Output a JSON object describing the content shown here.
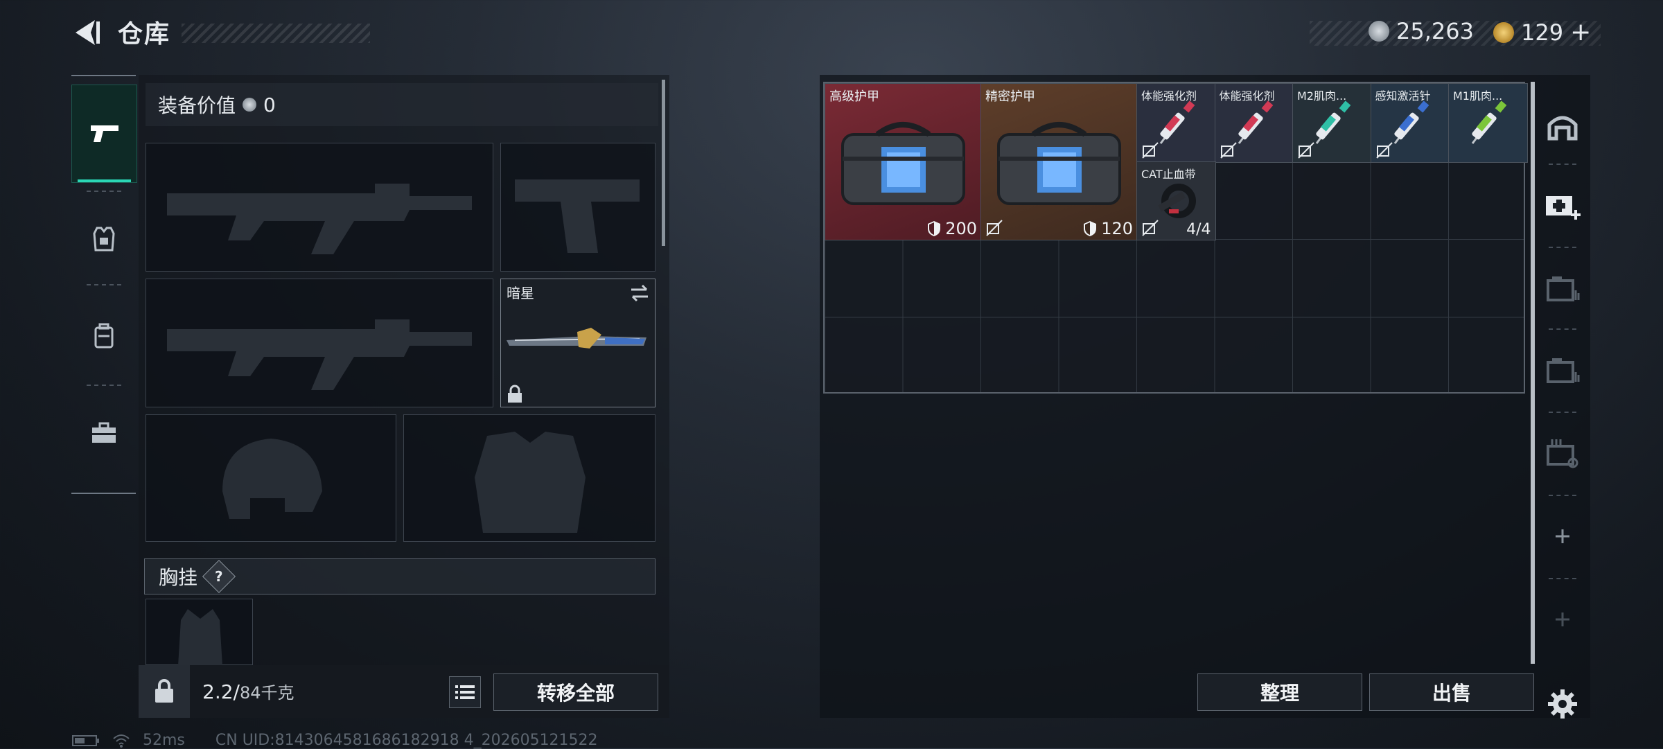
{
  "header": {
    "title": "仓库"
  },
  "currency": {
    "silver": "25,263",
    "gold": "129",
    "gold_add": "+"
  },
  "equipment": {
    "value_label": "装备价值",
    "value": "0",
    "melee_name": "暗星",
    "chest_rig_label": "胸挂",
    "chest_help": "?"
  },
  "footer": {
    "weight_current": "2.2/",
    "weight_max": "84千克",
    "transfer_all_label": "转移全部"
  },
  "stash": {
    "items": [
      {
        "name": "高级护甲",
        "value": "200"
      },
      {
        "name": "精密护甲",
        "value": "120"
      },
      {
        "name": "体能强化剂"
      },
      {
        "name": "体能强化剂"
      },
      {
        "name": "M2肌肉..."
      },
      {
        "name": "感知激活针"
      },
      {
        "name": "M1肌肉..."
      },
      {
        "name": "CAT止血带",
        "count": "4/4"
      }
    ],
    "sort_label": "整理",
    "sell_label": "出售"
  },
  "status": {
    "ping": "52ms",
    "uid": "CN UID:8143064581686182918 4_202605121522"
  },
  "colors": {
    "accent": "#2bd6b5",
    "rare_red": "#6e2630",
    "rare_gold": "#5a3b28"
  }
}
